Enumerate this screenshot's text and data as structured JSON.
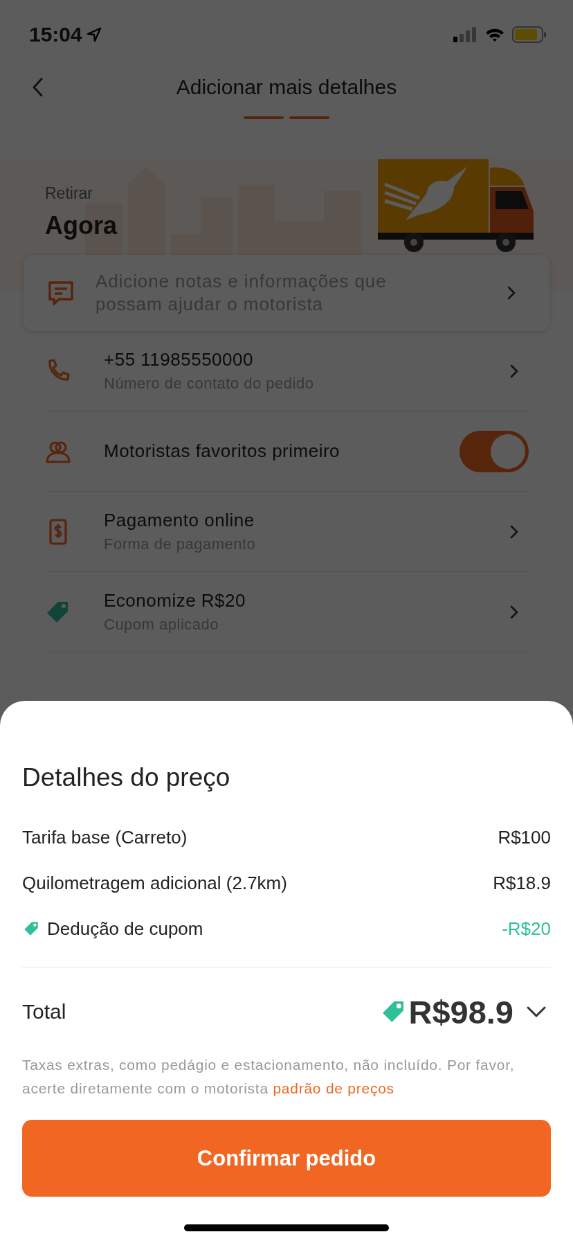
{
  "status_bar": {
    "time": "15:04"
  },
  "header": {
    "title": "Adicionar mais detalhes",
    "steps": [
      {
        "done": true
      },
      {
        "done": true
      }
    ]
  },
  "pickup": {
    "label": "Retirar",
    "value": "Agora"
  },
  "notes": {
    "placeholder": "Adicione notas e informações que possam ajudar o motorista"
  },
  "rows": [
    {
      "kind": "link",
      "title": "+55 11985550000",
      "subtitle": "Número de contato do pedido"
    },
    {
      "kind": "toggle",
      "title": "Motoristas favoritos primeiro",
      "on": true
    },
    {
      "kind": "link",
      "title": "Pagamento online",
      "subtitle": "Forma de pagamento"
    },
    {
      "kind": "link",
      "title": "Economize R$20",
      "subtitle": "Cupom aplicado"
    }
  ],
  "price_sheet": {
    "title": "Detalhes do preço",
    "lines": [
      {
        "kind": "charge",
        "label": "Tarifa base (Carreto)",
        "amount": "R$100"
      },
      {
        "kind": "charge",
        "label": "Quilometragem adicional (2.7km)",
        "amount": "R$18.9"
      },
      {
        "kind": "discount",
        "label": "Dedução de cupom",
        "amount": "-R$20"
      }
    ],
    "total_label": "Total",
    "total_amount": "R$98.9",
    "expanded": false,
    "note": "Taxas extras, como pedágio e estacionamento, não incluído. Por favor, acerte diretamente com o motorista",
    "note_link": "padrão de preços",
    "button": "Confirmar pedido"
  }
}
